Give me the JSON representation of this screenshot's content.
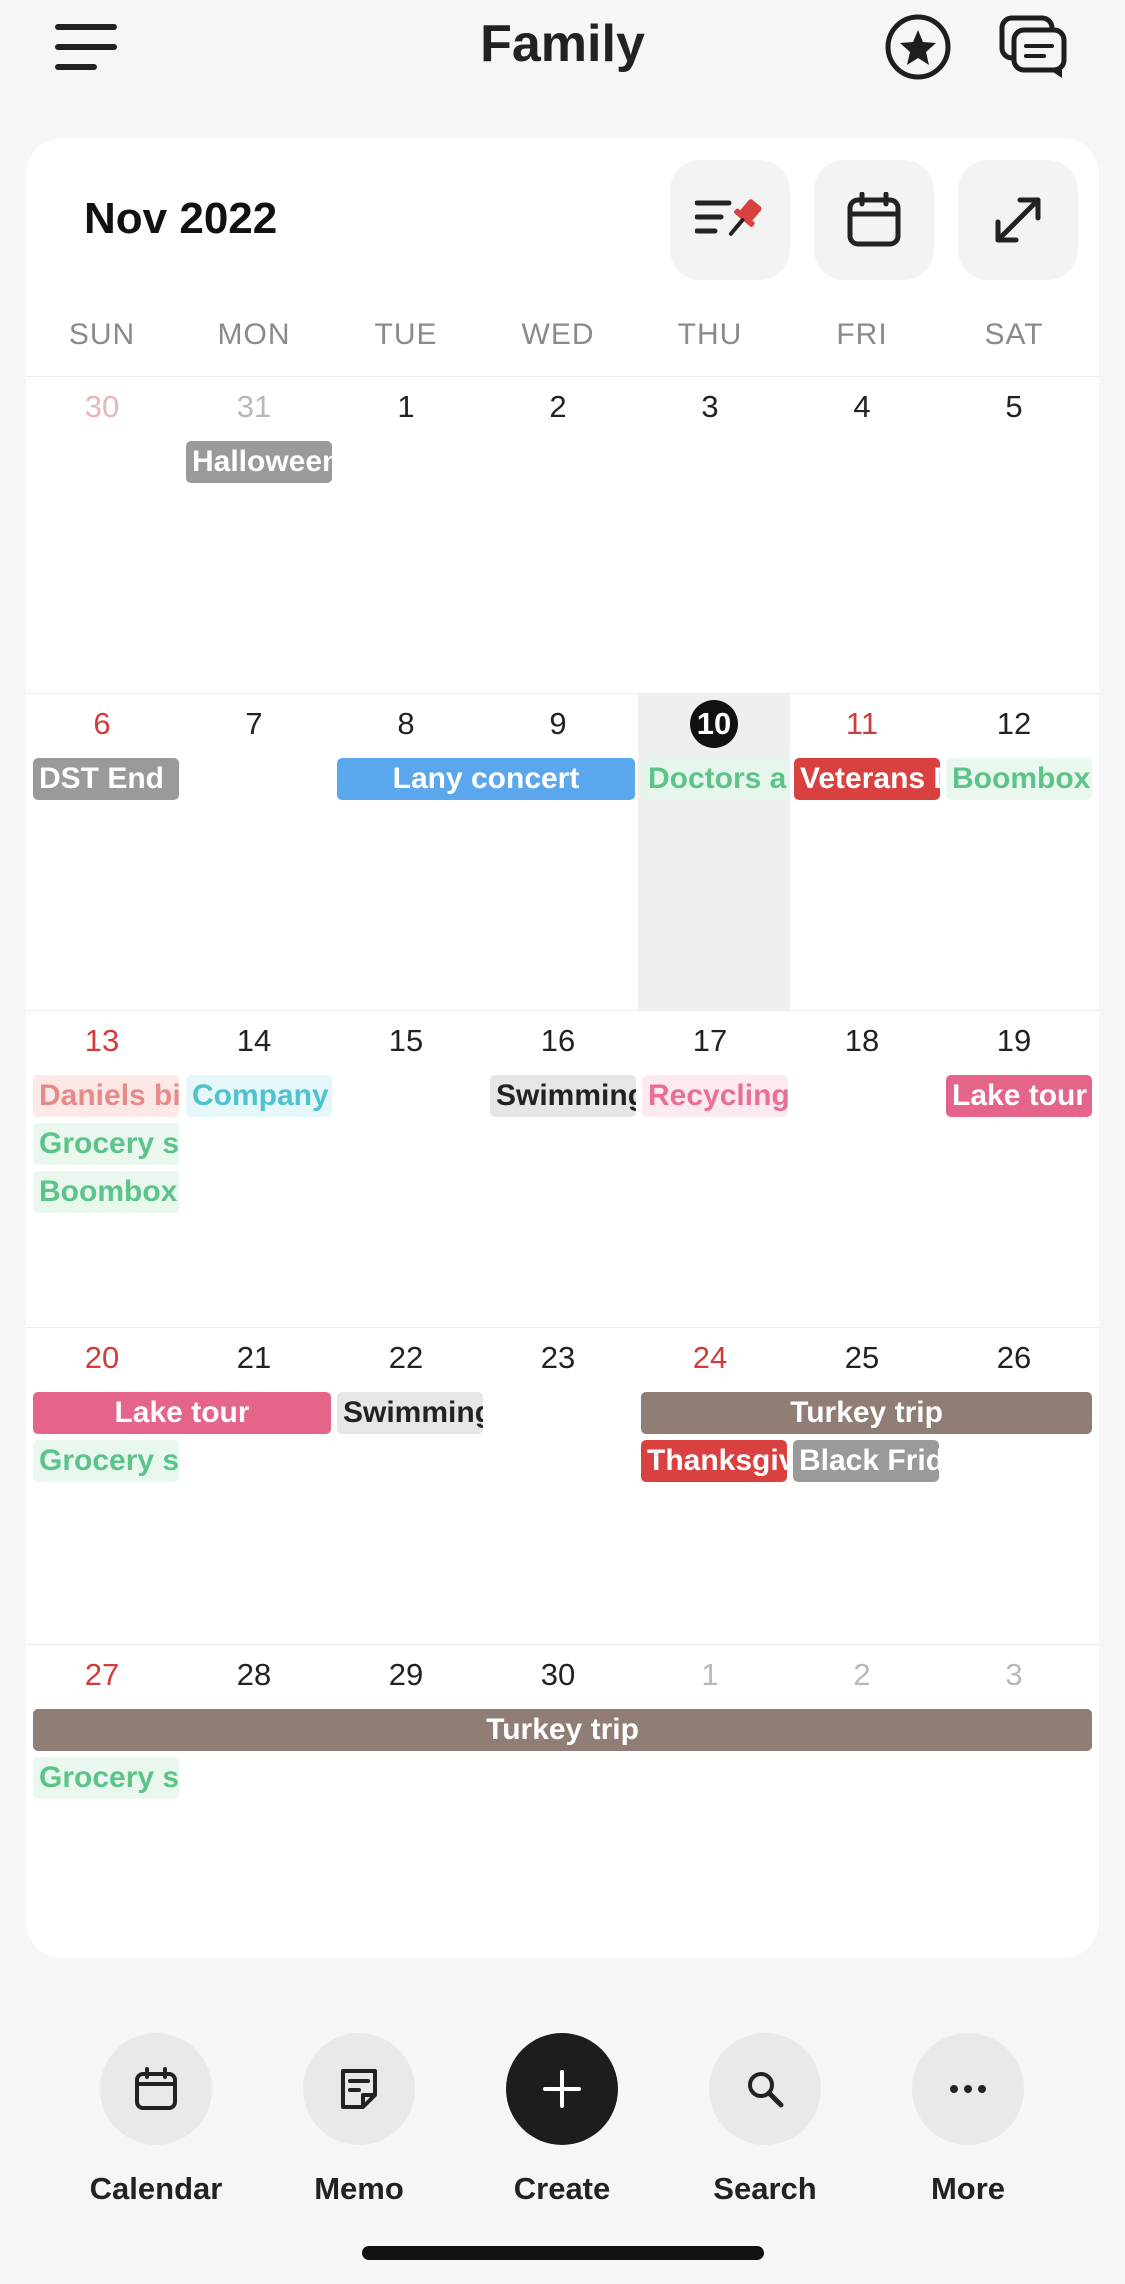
{
  "header": {
    "title": "Family"
  },
  "calendar": {
    "month_label": "Nov 2022",
    "weekdays": [
      "SUN",
      "MON",
      "TUE",
      "WED",
      "THU",
      "FRI",
      "SAT"
    ],
    "weeks": [
      {
        "days": [
          "30",
          "31",
          "1",
          "2",
          "3",
          "4",
          "5"
        ],
        "events": [
          {
            "title": "Halloween",
            "bg": "#9a9a9a",
            "fg": "#ffffff"
          }
        ]
      },
      {
        "days": [
          "6",
          "7",
          "8",
          "9",
          "10",
          "11",
          "12"
        ],
        "events": [
          {
            "title": "DST End",
            "bg": "#9a9a9a",
            "fg": "#ffffff"
          },
          {
            "title": "Lany concert",
            "bg": "#5aa7ee",
            "fg": "#ffffff"
          },
          {
            "title": "Doctors appointment",
            "bg": "#e6f6ec",
            "fg": "#5cc48a"
          },
          {
            "title": "Veterans Day",
            "bg": "#d94141",
            "fg": "#ffffff"
          },
          {
            "title": "Boombox",
            "bg": "#e9f7ef",
            "fg": "#5cc48a"
          }
        ]
      },
      {
        "days": [
          "13",
          "14",
          "15",
          "16",
          "17",
          "18",
          "19"
        ],
        "events": [
          {
            "title": "Daniels birthday",
            "bg": "#fde8e8",
            "fg": "#e78a8a"
          },
          {
            "title": "Company",
            "bg": "#e6f7f9",
            "fg": "#4fc2cf"
          },
          {
            "title": "Swimming",
            "bg": "#e6e6e6",
            "fg": "#222222"
          },
          {
            "title": "Recycling",
            "bg": "#fdeaf0",
            "fg": "#ea6f95"
          },
          {
            "title": "Lake tour",
            "bg": "#e4648a",
            "fg": "#ffffff"
          },
          {
            "title": "Grocery shopping",
            "bg": "#e9f7ef",
            "fg": "#5cc48a"
          },
          {
            "title": "Boombox",
            "bg": "#e9f7ef",
            "fg": "#5cc48a"
          }
        ]
      },
      {
        "days": [
          "20",
          "21",
          "22",
          "23",
          "24",
          "25",
          "26"
        ],
        "events": [
          {
            "title": "Lake tour",
            "bg": "#e4648a",
            "fg": "#ffffff"
          },
          {
            "title": "Swimming",
            "bg": "#e6e6e6",
            "fg": "#222222"
          },
          {
            "title": "Turkey trip",
            "bg": "#8f7d76",
            "fg": "#ffffff"
          },
          {
            "title": "Grocery shopping",
            "bg": "#e9f7ef",
            "fg": "#5cc48a"
          },
          {
            "title": "Thanksgiving",
            "bg": "#d94141",
            "fg": "#ffffff"
          },
          {
            "title": "Black Friday",
            "bg": "#9a9a9a",
            "fg": "#ffffff"
          }
        ]
      },
      {
        "days": [
          "27",
          "28",
          "29",
          "30",
          "1",
          "2",
          "3"
        ],
        "events": [
          {
            "title": "Turkey trip",
            "bg": "#8f7d76",
            "fg": "#ffffff"
          },
          {
            "title": "Grocery shopping",
            "bg": "#e9f7ef",
            "fg": "#5cc48a"
          }
        ]
      }
    ]
  },
  "nav": {
    "calendar": "Calendar",
    "memo": "Memo",
    "create": "Create",
    "search": "Search",
    "more": "More"
  },
  "icons": {
    "menu": "hamburger-icon",
    "favorites": "star-circle-icon",
    "chat": "chat-bubbles-icon",
    "pinned": "pinned-list-icon",
    "today": "calendar-icon",
    "expand": "expand-icon"
  },
  "colors": {
    "accent_red": "#d13b3b",
    "today_marker": "#111111",
    "today_column": "#efefef"
  }
}
